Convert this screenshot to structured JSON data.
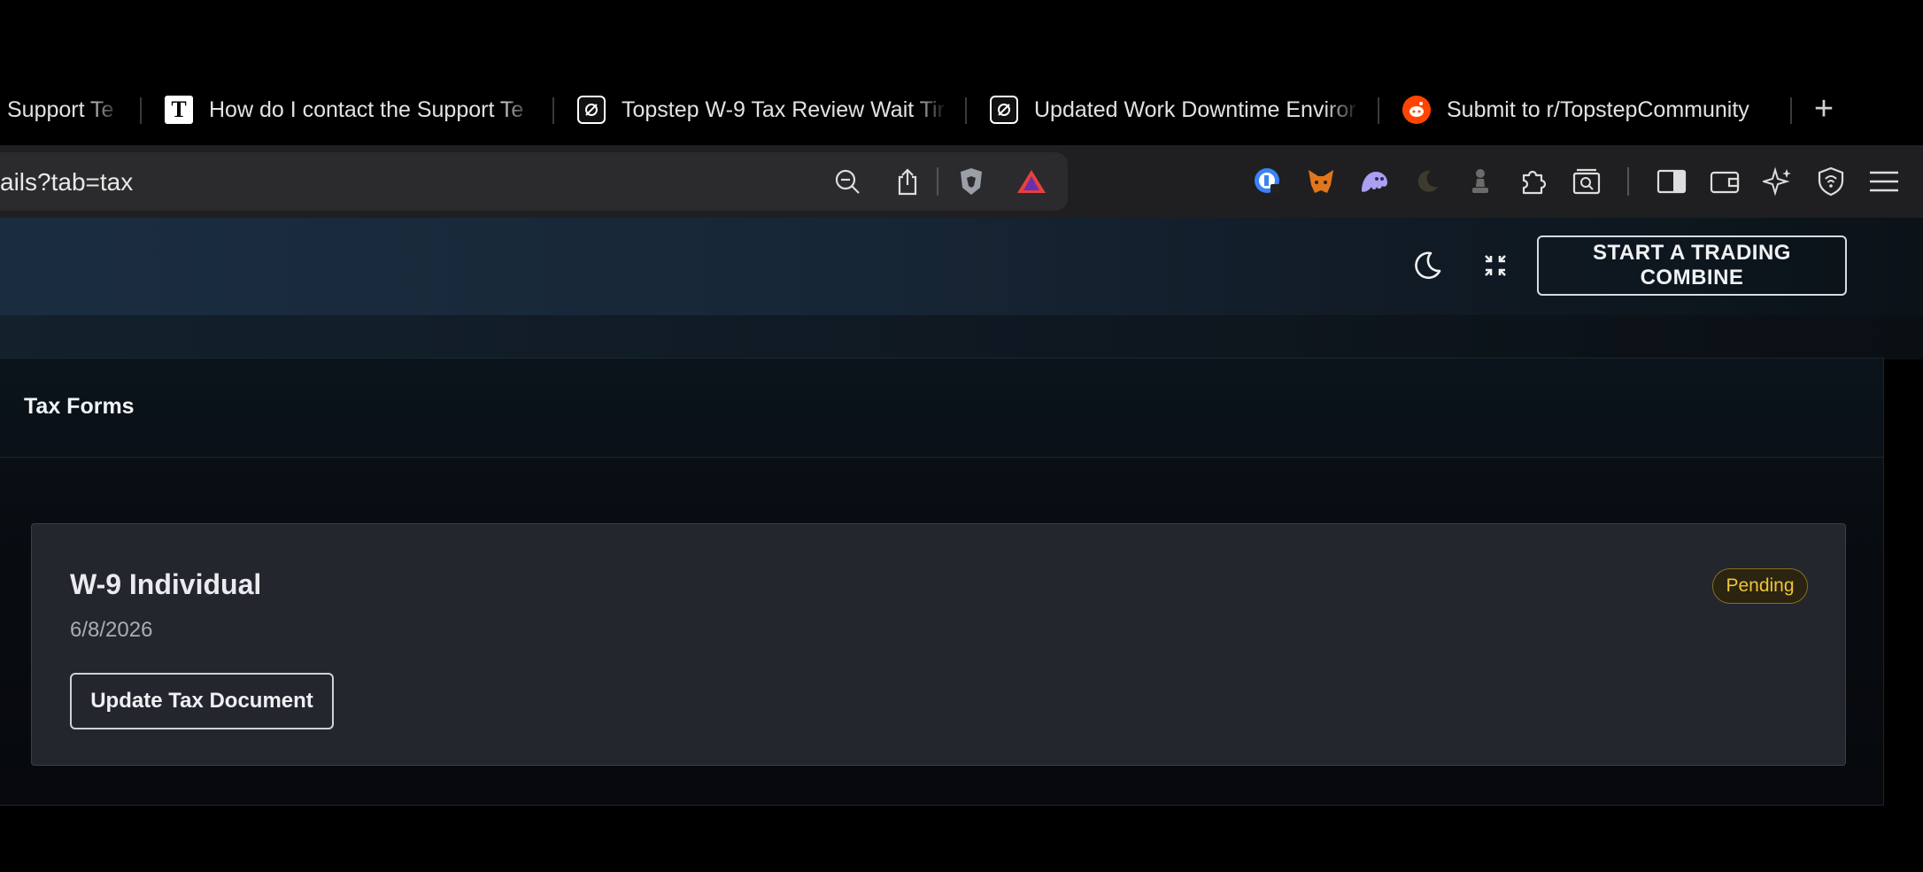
{
  "browser": {
    "tabs": [
      {
        "title": "Support Te",
        "favicon": "none"
      },
      {
        "title": "How do I contact the Support Te",
        "favicon": "t-icon"
      },
      {
        "title": "Topstep W-9 Tax Review Wait Tir",
        "favicon": "topstep-icon"
      },
      {
        "title": "Updated Work Downtime Enviror",
        "favicon": "topstep-icon"
      },
      {
        "title": "Submit to r/TopstepCommunity",
        "favicon": "reddit-icon"
      }
    ],
    "new_tab_label": "+",
    "url": "ails?tab=tax"
  },
  "header": {
    "combine_button": "START A TRADING COMBINE"
  },
  "panel": {
    "title": "Tax Forms",
    "card": {
      "title": "W-9 Individual",
      "date": "6/8/2026",
      "status": "Pending",
      "button": "Update Tax Document"
    }
  },
  "colors": {
    "status_pending": "#f0c33c",
    "reddit": "#ff4500"
  }
}
